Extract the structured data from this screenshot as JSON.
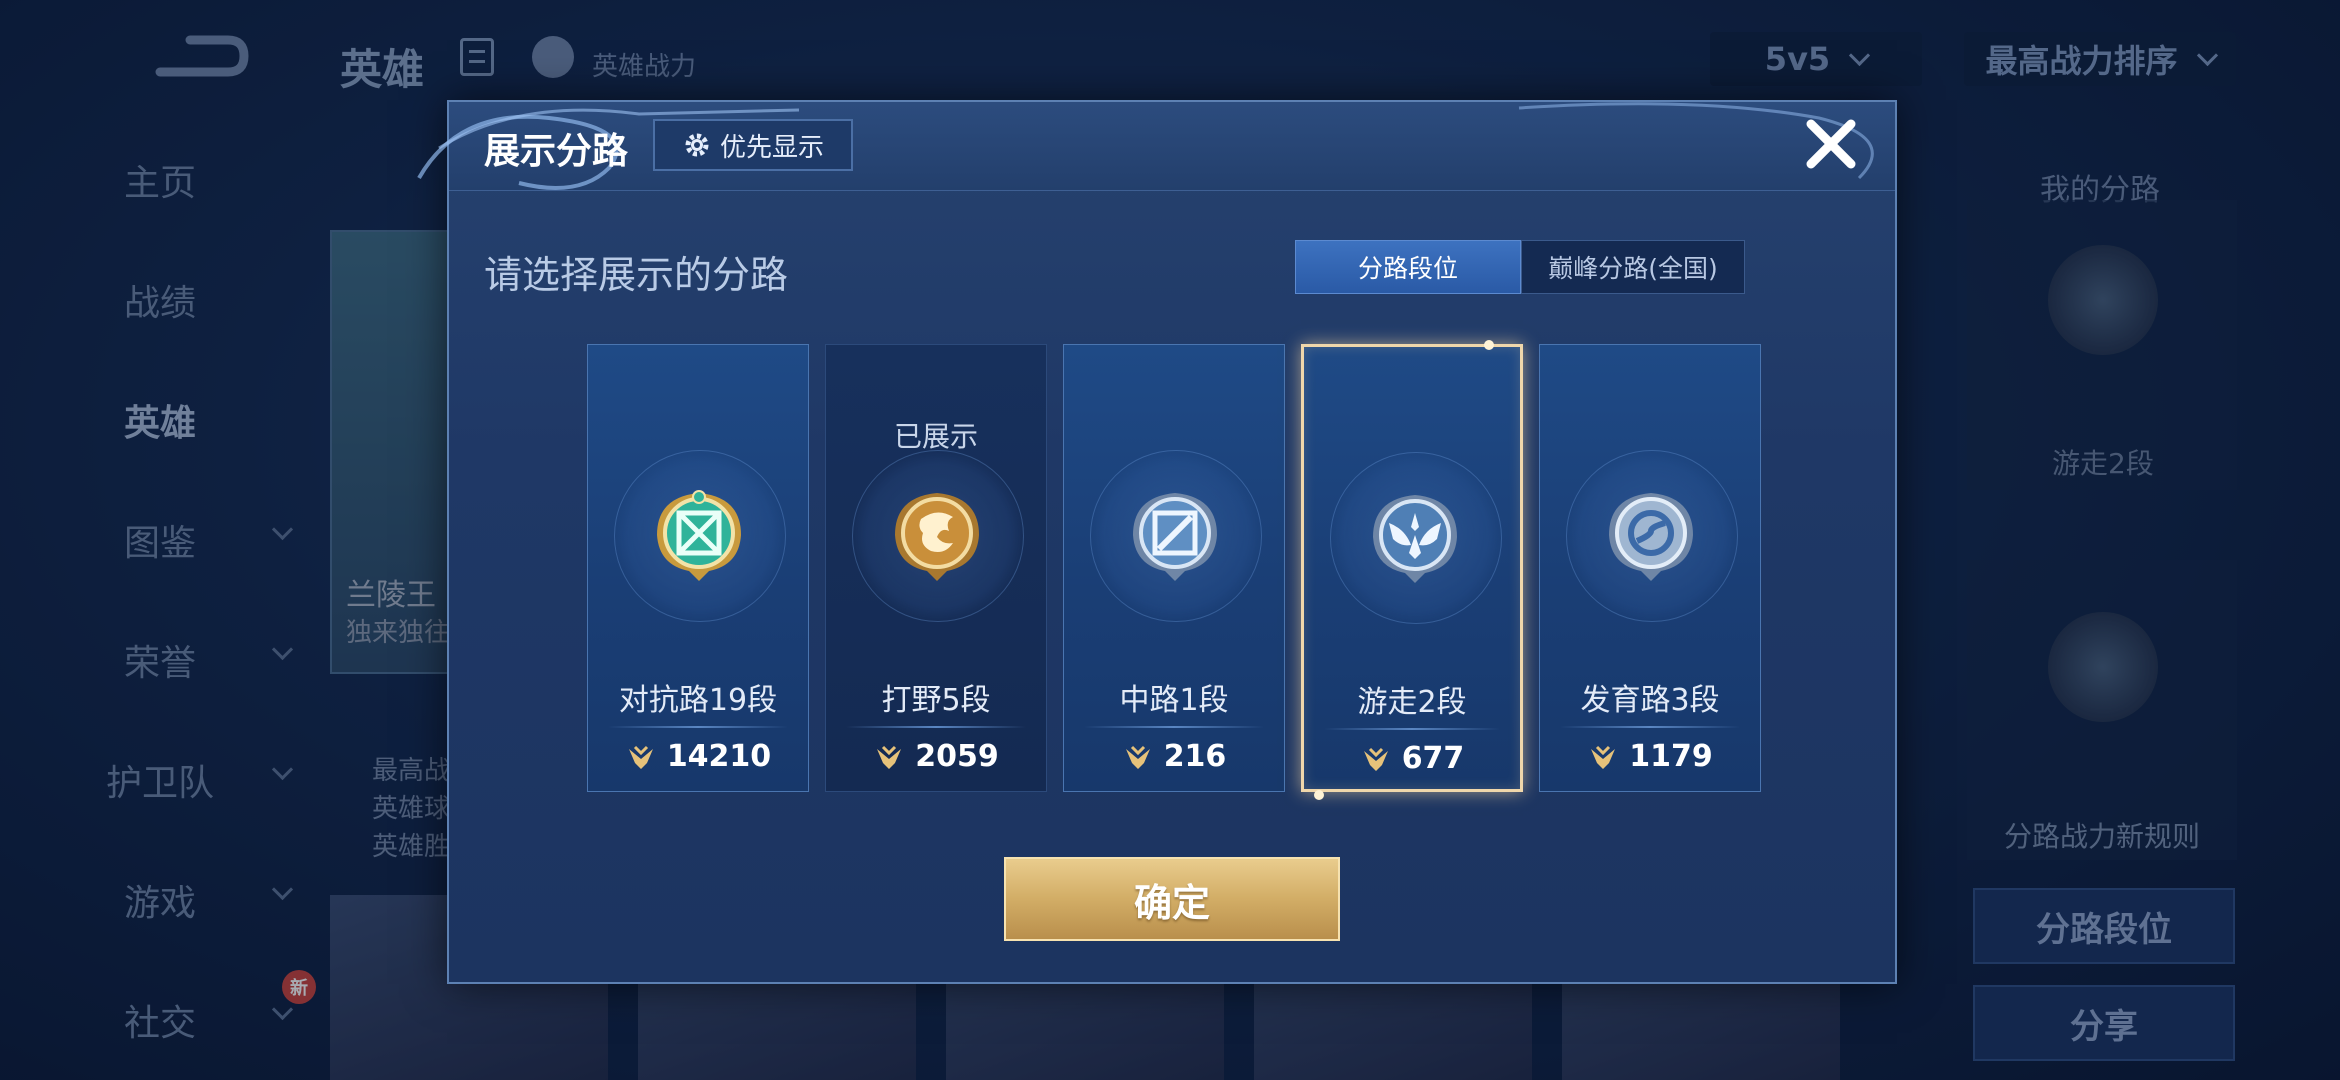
{
  "background": {
    "title": "英雄",
    "hero_power_label": "英雄战力",
    "mode": "5v5",
    "sort": "最高战力排序",
    "nav": [
      {
        "label": "主页",
        "has_chevron": false,
        "active": false
      },
      {
        "label": "战绩",
        "has_chevron": false,
        "active": false
      },
      {
        "label": "英雄",
        "has_chevron": false,
        "active": true
      },
      {
        "label": "图鉴",
        "has_chevron": true,
        "active": false
      },
      {
        "label": "荣誉",
        "has_chevron": true,
        "active": false
      },
      {
        "label": "护卫队",
        "has_chevron": true,
        "active": false
      },
      {
        "label": "游戏",
        "has_chevron": true,
        "active": false
      },
      {
        "label": "社交",
        "has_chevron": true,
        "active": false
      }
    ],
    "new_badge": "新",
    "hero_card": {
      "name": "兰陵王",
      "subtitle": "独来独往"
    },
    "info_lines": [
      "最高战",
      "英雄球",
      "英雄胜"
    ],
    "right_panel": {
      "title": "我的分路",
      "lane": "游走2段",
      "rule": "分路战力新规则",
      "lane_rank_button": "分路段位",
      "share_button": "分享"
    }
  },
  "modal": {
    "title": "展示分路",
    "priority_button": "优先显示",
    "prompt": "请选择展示的分路",
    "tabs": [
      {
        "label": "分路段位",
        "active": true
      },
      {
        "label": "巅峰分路(全国)",
        "active": false
      }
    ],
    "lanes": [
      {
        "name": "对抗路19段",
        "power": "14210",
        "shown": false,
        "selected": false,
        "emblem": "clash-lane-emblem-icon"
      },
      {
        "name": "打野5段",
        "power": "2059",
        "shown": true,
        "selected": false,
        "emblem": "jungle-emblem-icon"
      },
      {
        "name": "中路1段",
        "power": "216",
        "shown": false,
        "selected": false,
        "emblem": "mid-lane-emblem-icon"
      },
      {
        "name": "游走2段",
        "power": "677",
        "shown": false,
        "selected": true,
        "emblem": "roam-emblem-icon"
      },
      {
        "name": "发育路3段",
        "power": "1179",
        "shown": false,
        "selected": false,
        "emblem": "farm-lane-emblem-icon"
      }
    ],
    "shown_label": "已展示",
    "confirm": "确定"
  },
  "colors": {
    "accent_gold": "#d2ad66",
    "selected_border": "#f0d7ab",
    "tab_active": "#2a5aa6",
    "emblem_teal": "#2fb39a",
    "emblem_gold": "#c98f3a",
    "emblem_silver": "#9fb6d1"
  }
}
